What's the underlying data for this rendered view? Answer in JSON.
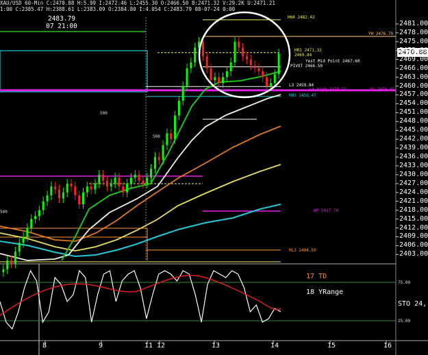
{
  "header": {
    "line1": "XAU/USD 60-Min C:2470.88 H:5.99 I:2472.46 L:2455.30 O:2466.50 B:2471.32 V:29.2K U:2471.21",
    "line2": "1:00 C:2385.47 H:2388.61 L:2383.09 O:2384.80 I:4.054 C:2483.79 08-07-24 0:00"
  },
  "info_box": {
    "price": "2483.79",
    "time": "07 21:00"
  },
  "last_price": "2470.88",
  "colors": {
    "up": "#00ff00",
    "down": "#ff2020",
    "ma_green": "#22c022",
    "ma_white": "#f4f4e8",
    "ma_orange": "#e07a20",
    "ma_yellow": "#e8e060",
    "ma_cyan": "#20c8d8",
    "magenta": "#e020e0",
    "circle": "#ffffff"
  },
  "level_tags": {
    "hh4": "HH4 2482.42",
    "yh": "YH 2476.79",
    "hr1": "HR1 2471.32",
    "hr1b": "2469.84",
    "mid": "Yest Mid Point 2467.60",
    "pivot": "PIVOT 2466.50",
    "l3": "L3 2459.84",
    "lh": "LA High 2458.55",
    "lh2": "YL 2458.45",
    "hh3": "HH3 2456.47",
    "wp": "WP 2417.70",
    "hl3": "HL3 2404.50"
  },
  "mini_labels": {
    "a": "500",
    "b": "500",
    "c": "500"
  },
  "indicator": {
    "td_label": "17 TD",
    "yrange_label": "18 YRange",
    "sto_label": "STO 24,",
    "tick_75": "75.00",
    "tick_25": "25.00"
  },
  "chart_data": {
    "type": "candlestick",
    "title": "XAU/USD 60-Min",
    "y_ticks": [
      "2481.00",
      "2478.00",
      "2475.00",
      "2472.00",
      "2469.00",
      "2466.00",
      "2463.00",
      "2460.00",
      "2457.00",
      "2454.00",
      "2451.00",
      "2448.00",
      "2445.00",
      "2442.00",
      "2439.00",
      "2436.00",
      "2433.00",
      "2430.00",
      "2427.00",
      "2424.00",
      "2421.00",
      "2418.00",
      "2415.00",
      "2412.00",
      "2409.00",
      "2406.00",
      "2403.00"
    ],
    "x_ticks": [
      "8",
      "9",
      "11",
      "12",
      "13",
      "14",
      "15",
      "16"
    ],
    "ylim": [
      2401,
      2484
    ],
    "levels": [
      {
        "name": "HH4",
        "value": 2482.42
      },
      {
        "name": "YH",
        "value": 2476.79
      },
      {
        "name": "HR1",
        "value": 2471.32
      },
      {
        "name": "Yest Mid Point",
        "value": 2467.6
      },
      {
        "name": "PIVOT",
        "value": 2466.5
      },
      {
        "name": "L3",
        "value": 2459.84
      },
      {
        "name": "LA High",
        "value": 2458.55
      },
      {
        "name": "HH3",
        "value": 2456.47
      },
      {
        "name": "WP",
        "value": 2417.7
      },
      {
        "name": "HL3",
        "value": 2404.5
      }
    ],
    "candles_close": [
      2398,
      2401,
      2400,
      2404,
      2407,
      2409,
      2412,
      2415,
      2416,
      2418,
      2421,
      2423,
      2426,
      2425,
      2422,
      2424,
      2427,
      2426,
      2423,
      2420,
      2424,
      2426,
      2425,
      2427,
      2430,
      2428,
      2426,
      2427,
      2429,
      2426,
      2424,
      2427,
      2429,
      2430,
      2428,
      2427,
      2429,
      2432,
      2436,
      2435,
      2440,
      2444,
      2442,
      2450,
      2455,
      2460,
      2466,
      2468,
      2473,
      2475,
      2470,
      2466,
      2462,
      2463,
      2461,
      2463,
      2465,
      2468,
      2475,
      2473,
      2470,
      2469,
      2467,
      2466,
      2465,
      2463,
      2460,
      2461,
      2464,
      2471
    ]
  }
}
